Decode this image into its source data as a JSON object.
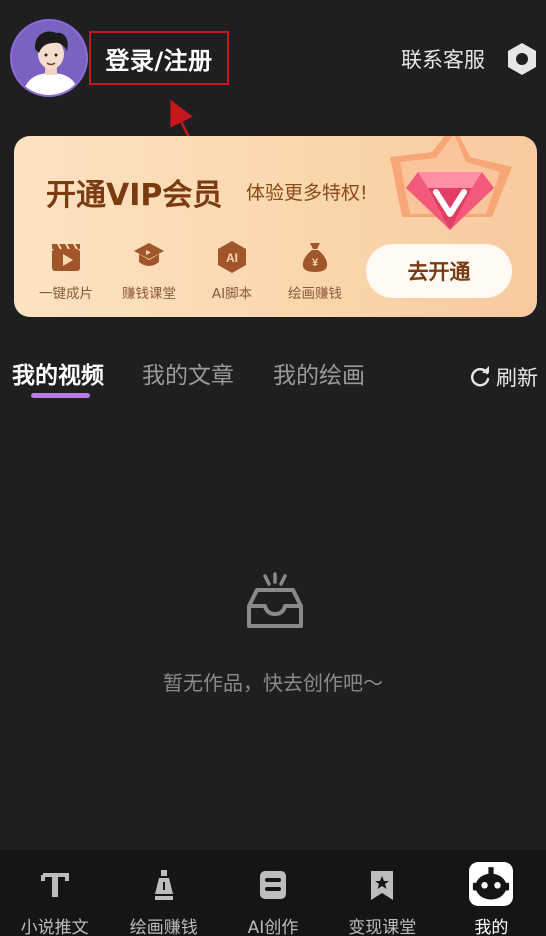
{
  "header": {
    "login_label": "登录/注册",
    "contact_label": "联系客服"
  },
  "vip": {
    "title": "开通VIP会员",
    "subtitle": "体验更多特权!",
    "benefits": [
      {
        "label": "一键成片",
        "icon": "clapperboard-icon"
      },
      {
        "label": "赚钱课堂",
        "icon": "graduation-cap-icon"
      },
      {
        "label": "AI脚本",
        "icon": "ai-hexagon-icon"
      },
      {
        "label": "绘画赚钱",
        "icon": "money-bag-icon"
      }
    ],
    "open_label": "去开通"
  },
  "tabs": {
    "items": [
      {
        "label": "我的视频",
        "active": true
      },
      {
        "label": "我的文章",
        "active": false
      },
      {
        "label": "我的绘画",
        "active": false
      }
    ],
    "refresh_label": "刷新"
  },
  "empty": {
    "message": "暂无作品，快去创作吧～"
  },
  "bottom_nav": {
    "items": [
      {
        "label": "小说推文",
        "icon": "text-t-icon"
      },
      {
        "label": "绘画赚钱",
        "icon": "pen-nib-icon"
      },
      {
        "label": "AI创作",
        "icon": "ai-create-icon"
      },
      {
        "label": "变现课堂",
        "icon": "bookmark-star-icon"
      },
      {
        "label": "我的",
        "icon": "robot-face-icon",
        "active": true
      }
    ]
  },
  "colors": {
    "background": "#1f1f21",
    "accent_purple": "#b87cf0",
    "vip_brown": "#7a3a12",
    "annotation_red": "#c8161d"
  }
}
